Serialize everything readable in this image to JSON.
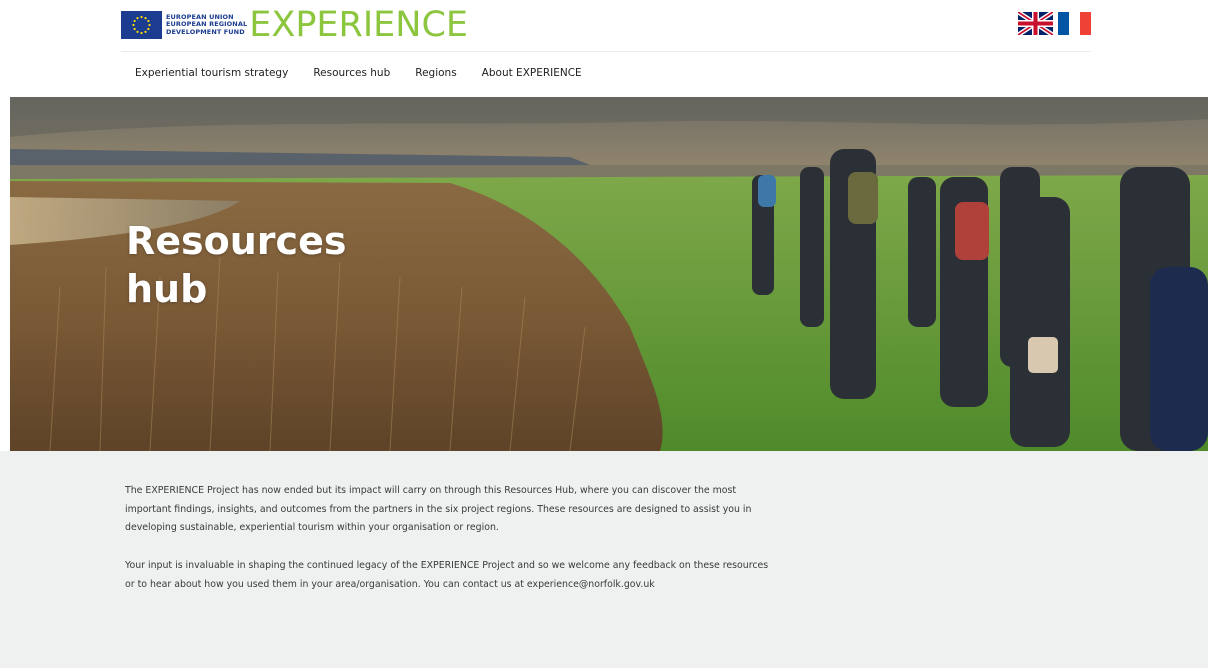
{
  "header": {
    "eu_text": [
      "EUROPEAN UNION",
      "EUROPEAN REGIONAL",
      "DEVELOPMENT FUND"
    ],
    "brand": "EXPERIENCE",
    "languages": [
      {
        "code": "en",
        "icon": "uk-flag-icon"
      },
      {
        "code": "fr",
        "icon": "france-flag-icon",
        "colors": [
          "#0055a4",
          "#ffffff",
          "#ef4135"
        ]
      }
    ]
  },
  "nav": {
    "items": [
      {
        "label": "Experiential tourism strategy"
      },
      {
        "label": "Resources hub"
      },
      {
        "label": "Regions"
      },
      {
        "label": "About EXPERIENCE"
      }
    ]
  },
  "hero": {
    "title_line1": "Resources",
    "title_line2": "hub"
  },
  "content": {
    "paragraph1": "The EXPERIENCE Project has now ended but its impact will carry on through this Resources Hub, where you can discover the most important findings, insights, and outcomes from the partners in the six project regions. These resources are designed to assist you in developing sustainable, experiential tourism within your organisation or region.",
    "paragraph2": "Your input is invaluable in shaping the continued legacy of the EXPERIENCE Project and so we welcome any feedback on these resources or to hear about how you used them in your area/organisation. You can contact us at experience@norfolk.gov.uk"
  },
  "colors": {
    "brand_green": "#8cc63f",
    "eu_blue": "#1b3c8f",
    "content_bg": "#eef1ef"
  }
}
